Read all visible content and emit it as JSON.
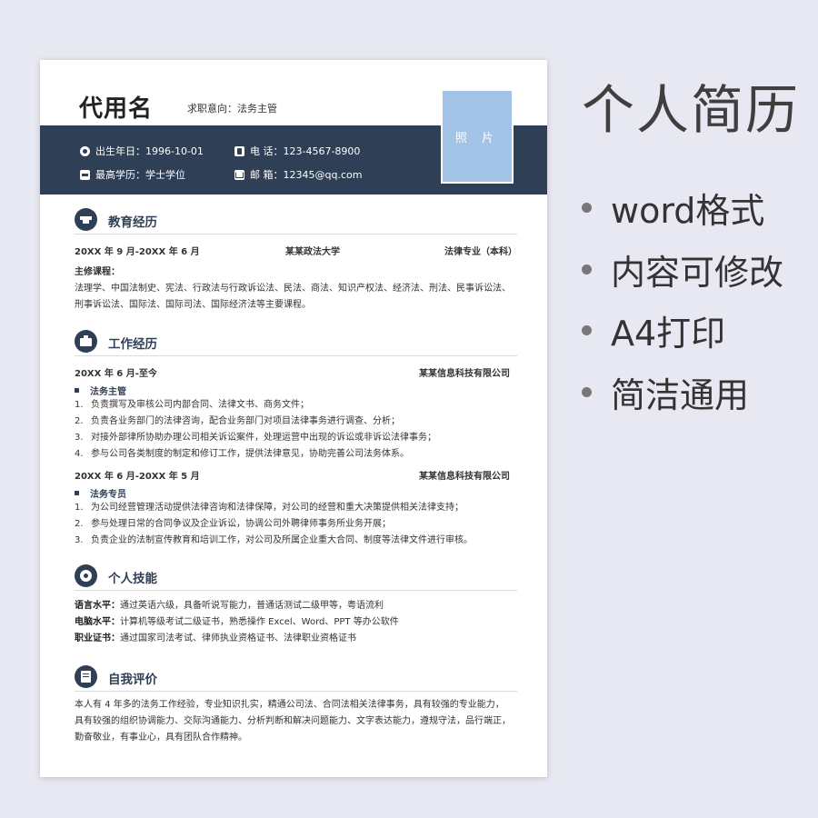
{
  "resume": {
    "name": "代用名",
    "intent": "求职意向：法务主管",
    "info": {
      "birth": "出生年日：1996-10-01",
      "phone": "电  话：123-4567-8900",
      "education": "最高学历：学士学位",
      "email": "邮  箱：12345@qq.com"
    },
    "photo_label": "照 片",
    "education": {
      "title": "教育经历",
      "period": "20XX 年 9 月-20XX 年 6 月",
      "school": "某某政法大学",
      "major": "法律专业（本科）",
      "courses_label": "主修课程：",
      "courses_line1": "法理学、中国法制史、宪法、行政法与行政诉讼法、民法、商法、知识产权法、经济法、刑法、民事诉讼法、",
      "courses_line2": "刑事诉讼法、国际法、国际司法、国际经济法等主要课程。"
    },
    "work": {
      "title": "工作经历",
      "jobs": [
        {
          "period": "20XX 年 6 月-至今",
          "company": "某某信息科技有限公司",
          "role": "法务主管",
          "items": [
            "负责撰写及审核公司内部合同、法律文书、商务文件；",
            "负责各业务部门的法律咨询，配合业务部门对项目法律事务进行调查、分析；",
            "对接外部律所协助办理公司相关诉讼案件，处理运营中出现的诉讼或非诉讼法律事务；",
            "参与公司各类制度的制定和修订工作，提供法律意见，协助完善公司法务体系。"
          ]
        },
        {
          "period": "20XX 年 6 月-20XX 年 5 月",
          "company": "某某信息科技有限公司",
          "role": "法务专员",
          "items": [
            "为公司经营管理活动提供法律咨询和法律保障，对公司的经营和重大决策提供相关法律支持；",
            "参与处理日常的合同争议及企业诉讼，协调公司外聘律师事务所业务开展；",
            "负责企业的法制宣传教育和培训工作，对公司及所属企业重大合同、制度等法律文件进行审核。"
          ]
        }
      ]
    },
    "skills": {
      "title": "个人技能",
      "lines": [
        {
          "label": "语言水平：",
          "text": "通过英语六级，具备听说写能力，普通话测试二级甲等，粤语流利"
        },
        {
          "label": "电脑水平：",
          "text": "计算机等级考试二级证书，熟悉操作 Excel、Word、PPT 等办公软件"
        },
        {
          "label": "职业证书：",
          "text": "通过国家司法考试、律师执业资格证书、法律职业资格证书"
        }
      ]
    },
    "self_eval": {
      "title": "自我评价",
      "line1": "本人有 4 年多的法务工作经验，专业知识扎实，精通公司法、合同法相关法律事务，具有较强的专业能力，",
      "line2": "具有较强的组织协调能力、交际沟通能力、分析判断和解决问题能力、文字表达能力，遵规守法，品行端正，",
      "line3": "勤奋敬业，有事业心，具有团队合作精神。"
    }
  },
  "side": {
    "title": "个人简历",
    "bullets": [
      "word格式",
      "内容可修改",
      "A4打印",
      "简洁通用"
    ]
  }
}
